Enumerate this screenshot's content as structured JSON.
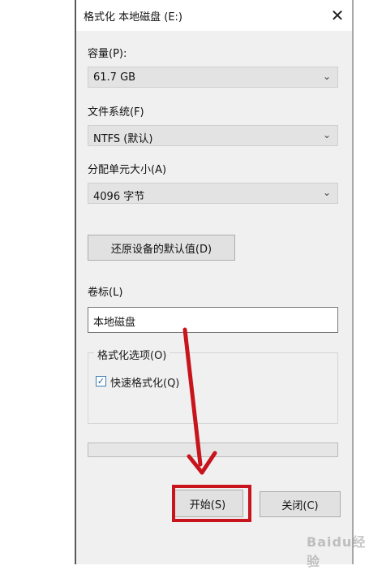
{
  "dialog": {
    "title": "格式化 本地磁盘 (E:)",
    "close_glyph": "✕"
  },
  "capacity": {
    "label": "容量(P):",
    "value": "61.7 GB"
  },
  "filesystem": {
    "label": "文件系统(F)",
    "value": "NTFS (默认)"
  },
  "allocation": {
    "label": "分配单元大小(A)",
    "value": "4096 字节"
  },
  "restore_button": {
    "label": "还原设备的默认值(D)"
  },
  "volume": {
    "label": "卷标(L)",
    "value": "本地磁盘"
  },
  "format_options": {
    "title": "格式化选项(O)",
    "quick_format": {
      "label": "快速格式化(Q)",
      "checked": true
    }
  },
  "progress": {
    "value": 0
  },
  "footer": {
    "start_label": "开始(S)",
    "close_label": "关闭(C)"
  },
  "annotation": {
    "color": "#c8141c"
  },
  "watermark": {
    "text": "Baidu经验"
  }
}
